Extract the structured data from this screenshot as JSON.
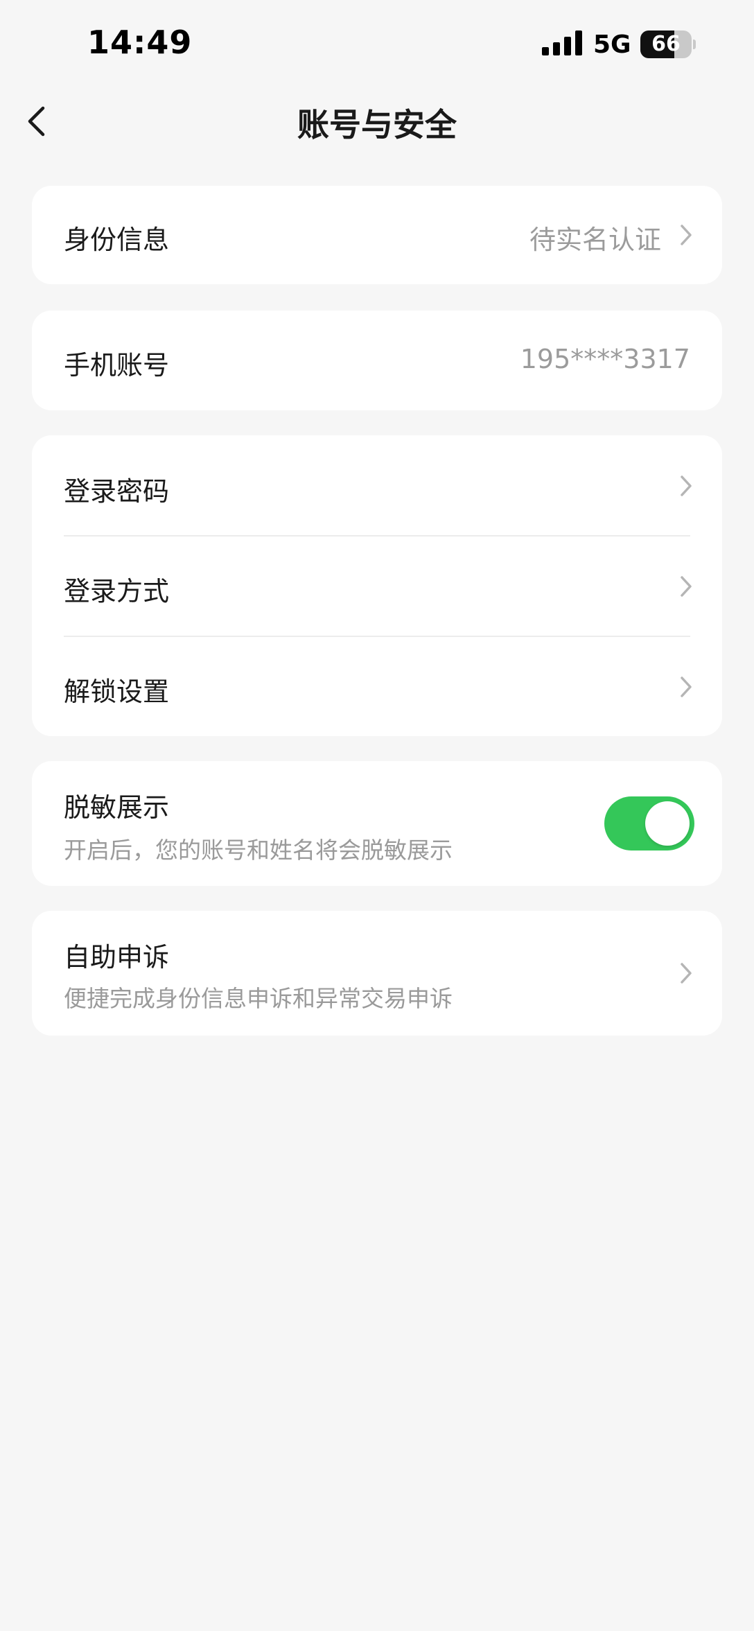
{
  "status_bar": {
    "time": "14:49",
    "network": "5G",
    "battery": "66",
    "battery_level": 0.66
  },
  "nav": {
    "title": "账号与安全",
    "back_icon": "chevron-left-icon"
  },
  "identity": {
    "label": "身份信息",
    "value": "待实名认证"
  },
  "phone": {
    "label": "手机账号",
    "value": "195****3317"
  },
  "login_group": {
    "items": [
      {
        "label": "登录密码"
      },
      {
        "label": "登录方式"
      },
      {
        "label": "解锁设置"
      }
    ]
  },
  "masking": {
    "label": "脱敏展示",
    "description": "开启后，您的账号和姓名将会脱敏展示",
    "enabled": true
  },
  "appeal": {
    "label": "自助申诉",
    "description": "便捷完成身份信息申诉和异常交易申诉"
  },
  "colors": {
    "toggle_on": "#34c759",
    "chevron": "#b5b5b5",
    "secondary_text": "#9b9b9b"
  }
}
